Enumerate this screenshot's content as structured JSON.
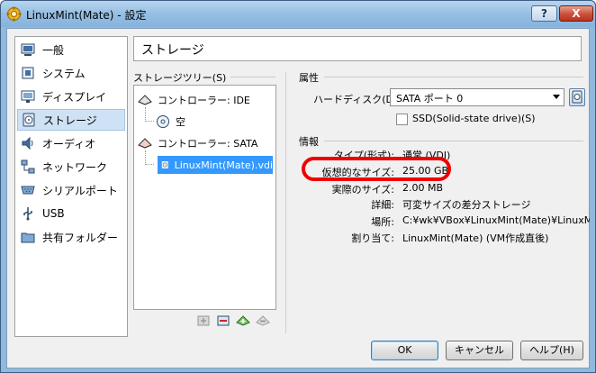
{
  "window": {
    "title": "LinuxMint(Mate) - 設定",
    "help_button": "?",
    "close_button": "X"
  },
  "sidebar": {
    "items": [
      {
        "label": "一般",
        "icon": "general-icon"
      },
      {
        "label": "システム",
        "icon": "system-icon"
      },
      {
        "label": "ディスプレイ",
        "icon": "display-icon"
      },
      {
        "label": "ストレージ",
        "icon": "storage-icon",
        "selected": true
      },
      {
        "label": "オーディオ",
        "icon": "audio-icon"
      },
      {
        "label": "ネットワーク",
        "icon": "network-icon"
      },
      {
        "label": "シリアルポート",
        "icon": "serial-port-icon"
      },
      {
        "label": "USB",
        "icon": "usb-icon"
      },
      {
        "label": "共有フォルダー",
        "icon": "shared-folder-icon"
      }
    ]
  },
  "page_title": "ストレージ",
  "tree": {
    "header": "ストレージツリー(S)",
    "rows": [
      {
        "label": "コントローラー: IDE",
        "icon": "ide-controller-icon"
      },
      {
        "label": "空",
        "icon": "optical-disc-icon"
      },
      {
        "label": "コントローラー: SATA",
        "icon": "sata-controller-icon"
      },
      {
        "label": "LinuxMint(Mate).vdi",
        "icon": "hard-disk-icon",
        "selected": true
      }
    ]
  },
  "attributes": {
    "header": "属性",
    "hard_disk_label": "ハードディスク(D):",
    "hard_disk_value": "SATA ポート 0",
    "ssd_label": "SSD(Solid-state drive)(S)",
    "ssd_checked": false
  },
  "info": {
    "header": "情報",
    "rows": [
      {
        "label": "タイプ(形式):",
        "value": "通常 (VDI)"
      },
      {
        "label": "仮想的なサイズ:",
        "value": "25.00 GB"
      },
      {
        "label": "実際のサイズ:",
        "value": "2.00 MB"
      },
      {
        "label": "詳細:",
        "value": "可変サイズの差分ストレージ"
      },
      {
        "label": "場所:",
        "value": "C:¥wk¥VBox¥LinuxMint(Mate)¥LinuxMint(Mate).vdi"
      },
      {
        "label": "割り当て:",
        "value": "LinuxMint(Mate) (VM作成直後)"
      }
    ]
  },
  "buttons": {
    "ok": "OK",
    "cancel": "キャンセル",
    "help": "ヘルプ(H)"
  },
  "colors": {
    "title_bar": "#96bfe3",
    "selection": "#3399ff",
    "highlight": "#ee0000"
  }
}
